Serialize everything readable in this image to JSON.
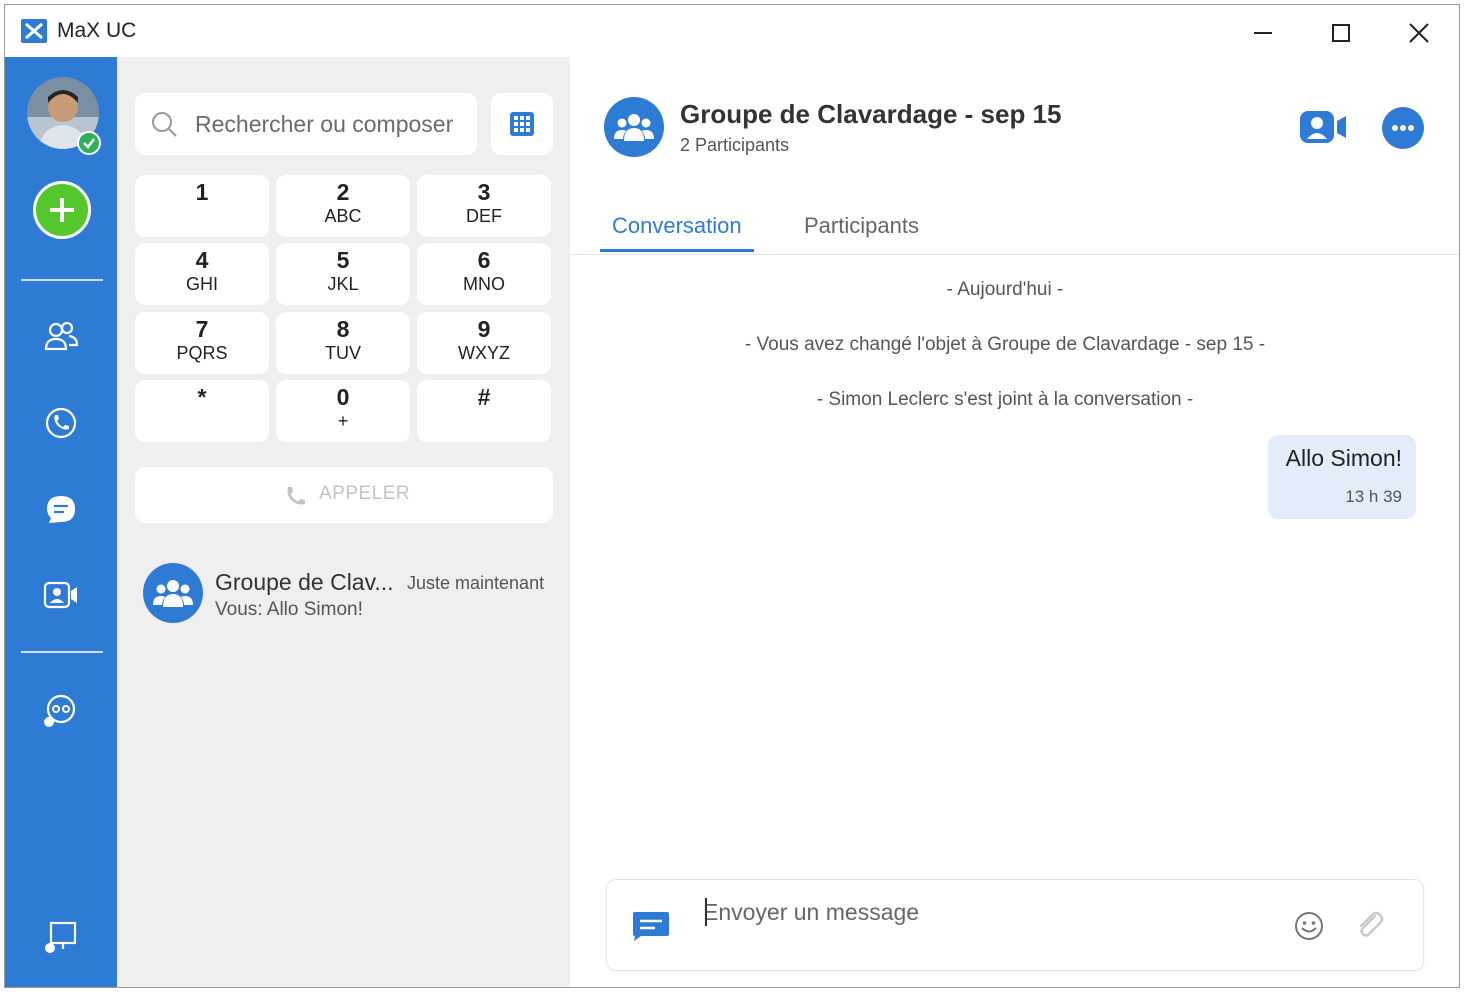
{
  "window": {
    "title": "MaX UC"
  },
  "dialer": {
    "search_placeholder": "Rechercher ou composer",
    "keys": [
      {
        "digit": "1",
        "letters": ""
      },
      {
        "digit": "2",
        "letters": "ABC"
      },
      {
        "digit": "3",
        "letters": "DEF"
      },
      {
        "digit": "4",
        "letters": "GHI"
      },
      {
        "digit": "5",
        "letters": "JKL"
      },
      {
        "digit": "6",
        "letters": "MNO"
      },
      {
        "digit": "7",
        "letters": "PQRS"
      },
      {
        "digit": "8",
        "letters": "TUV"
      },
      {
        "digit": "9",
        "letters": "WXYZ"
      },
      {
        "digit": "*",
        "letters": ""
      },
      {
        "digit": "0",
        "letters": "+"
      },
      {
        "digit": "#",
        "letters": ""
      }
    ],
    "call_label": "APPELER"
  },
  "conversations": [
    {
      "name": "Groupe de Clav...",
      "time": "Juste maintenant",
      "preview": "Vous: Allo Simon!"
    }
  ],
  "chat": {
    "title": "Groupe de Clavardage - sep 15",
    "subtitle": "2 Participants",
    "tabs": [
      "Conversation",
      "Participants"
    ],
    "system_messages": [
      "- Aujourd'hui -",
      "- Vous avez changé l'objet à Groupe de Clavardage - sep 15 -",
      "- Simon Leclerc s'est joint à la conversation -"
    ],
    "messages": [
      {
        "text": "Allo Simon!",
        "time": "13 h 39"
      }
    ],
    "composer_placeholder": "Envoyer un message"
  },
  "colors": {
    "accent": "#2e7bd6",
    "add_button": "#55c62b",
    "status_online": "#2fb15b",
    "panel_bg": "#efefef",
    "bubble_bg": "#e3edf9"
  },
  "icons": {
    "rail": [
      "contacts-icon",
      "phone-icon",
      "chat-icon",
      "video-meeting-icon",
      "voicemail-icon",
      "screen-share-icon"
    ]
  }
}
